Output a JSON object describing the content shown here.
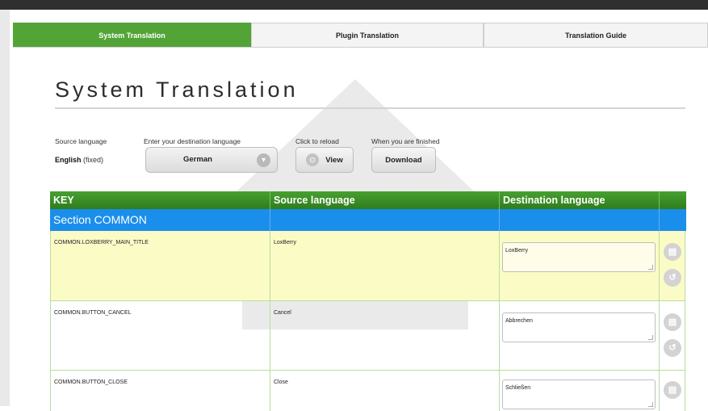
{
  "tabs": [
    {
      "label": "System Translation",
      "active": true
    },
    {
      "label": "Plugin Translation",
      "active": false
    },
    {
      "label": "Translation Guide",
      "active": false
    }
  ],
  "page_title": "System Translation",
  "form": {
    "source_label": "Source language",
    "source_value": "English",
    "source_suffix": "(fixed)",
    "dest_label": "Enter your destination language",
    "dest_value": "German",
    "reload_label": "Click to reload",
    "view_button": "View",
    "finished_label": "When you are finished",
    "download_button": "Download"
  },
  "table": {
    "headers": [
      "KEY",
      "Source language",
      "Destination language"
    ],
    "section": "Section COMMON",
    "rows": [
      {
        "key": "COMMON.LOXBERRY_MAIN_TITLE",
        "source": "LoxBerry",
        "dest": "LoxBerry"
      },
      {
        "key": "COMMON.BUTTON_CANCEL",
        "source": "Cancel",
        "dest": "Abbrechen"
      },
      {
        "key": "COMMON.BUTTON_CLOSE",
        "source": "Close",
        "dest": "Schließen"
      }
    ]
  },
  "colors": {
    "accent_green": "#53a436",
    "header_green": "#3a8f27",
    "section_blue": "#1a8eeb",
    "highlight_row": "#fbfbc6"
  },
  "icons": [
    "chevron-down-icon",
    "eye-icon",
    "save-icon",
    "undo-icon"
  ]
}
